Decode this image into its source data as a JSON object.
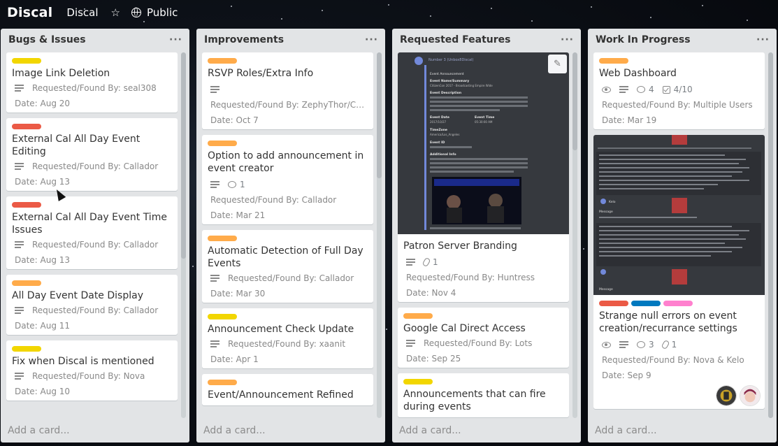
{
  "header": {
    "brand": "Discal",
    "board_name": "Discal",
    "star_icon": "star-icon",
    "visibility": "Public"
  },
  "colors": {
    "yellow": "#f2d600",
    "orange": "#ffab4a",
    "red": "#eb5a46",
    "blue": "#0079bf",
    "pink": "#ff80ce"
  },
  "lists": [
    {
      "title": "Bugs & Issues",
      "add_card": "Add a card...",
      "cards": [
        {
          "title": "Image Link Deletion",
          "requested": "Requested/Found By: seal308",
          "date": "Date: Aug 20"
        },
        {
          "title": "External Cal All Day Event Editing",
          "requested": "Requested/Found By: Callador",
          "date": "Date: Aug 13"
        },
        {
          "title": "External Cal All Day Event Time Issues",
          "requested": "Requested/Found By: Callador",
          "date": "Date: Aug 13"
        },
        {
          "title": "All Day Event Date Display",
          "requested": "Requested/Found By: Callador",
          "date": "Date: Aug 11"
        },
        {
          "title": "Fix when Discal is mentioned",
          "requested": "Requested/Found By: Nova",
          "date": "Date: Aug 10"
        }
      ]
    },
    {
      "title": "Improvements",
      "add_card": "Add a card...",
      "cards": [
        {
          "title": "RSVP Roles/Extra Info",
          "requested": "Requested/Found By: ZephyThor/Ca...",
          "date": "Date: Oct 7"
        },
        {
          "title": "Option to add announcement in event creator",
          "comments": "1",
          "requested": "Requested/Found By: Callador",
          "date": "Date: Mar 21"
        },
        {
          "title": "Automatic Detection of Full Day Events",
          "requested": "Requested/Found By: Callador",
          "date": "Date: Mar 30"
        },
        {
          "title": "Announcement Check Update",
          "requested": "Requested/Found By: xaanit",
          "date": "Date: Apr 1"
        },
        {
          "title": "Event/Announcement Refined"
        }
      ]
    },
    {
      "title": "Requested Features",
      "add_card": "Add a card...",
      "cards": [
        {
          "title": "Patron Server Branding",
          "attachments": "1",
          "requested": "Requested/Found By: Huntress",
          "date": "Date: Nov 4",
          "cover": {
            "line1": "Number 3 (Unbox8Discal)",
            "line2": "Event Announcement",
            "line3": "Event Name/Summary",
            "line4": "CitizenCon 2017 - Broadcasting Empire Wide",
            "line5": "Event Description",
            "line6": "Event Date",
            "line7": "2017/10/27",
            "line8": "Event Time",
            "line9": "05:30:00 AM",
            "line10": "TimeZone",
            "line11": "America/Los_Angeles",
            "line12": "Event ID",
            "line13": "Additional Info"
          }
        },
        {
          "title": "Google Cal Direct Access",
          "requested": "Requested/Found By: Lots",
          "date": "Date: Sep 25"
        },
        {
          "title": "Announcements that can fire during events"
        }
      ]
    },
    {
      "title": "Work In Progress",
      "add_card": "Add a card...",
      "cards": [
        {
          "title": "Web Dashboard",
          "comments": "4",
          "checklist": "4/10",
          "requested": "Requested/Found By: Multiple Users",
          "date": "Date: Mar 19"
        },
        {
          "title": "Strange null errors on event creation/recurrance settings",
          "comments": "3",
          "attachments": "1",
          "requested": "Requested/Found By: Nova & Kelo",
          "date": "Date: Sep 9",
          "cover": {
            "label1": "Kelo",
            "label2": "Message"
          }
        }
      ]
    }
  ]
}
